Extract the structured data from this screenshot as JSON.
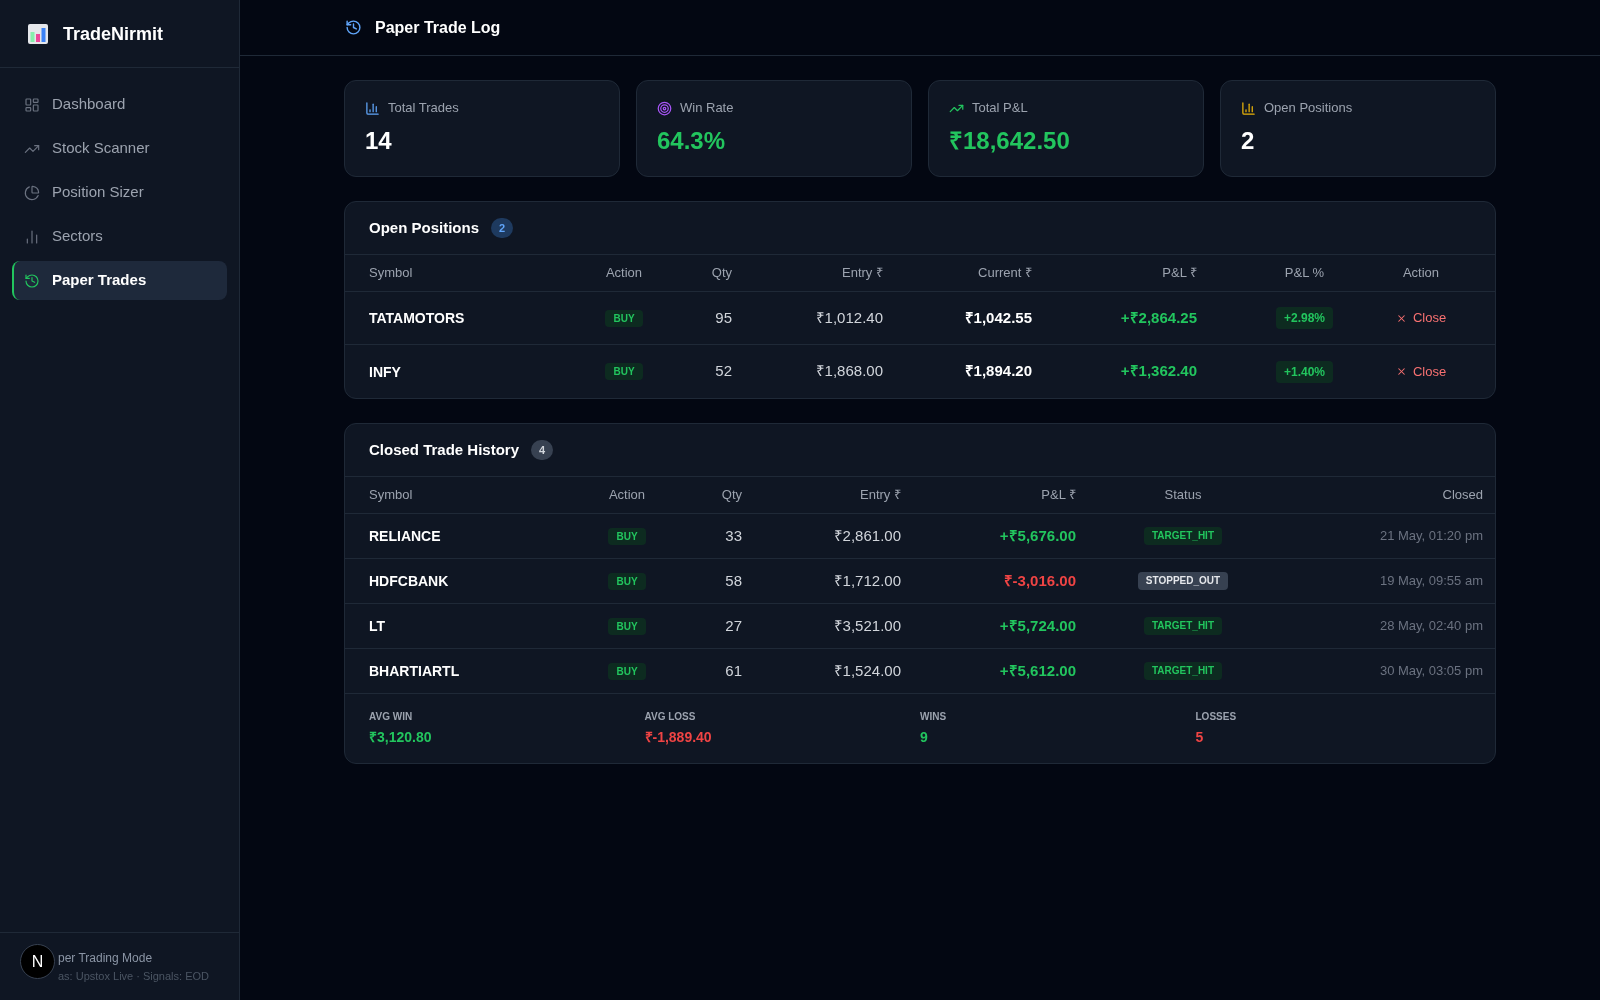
{
  "sidebar": {
    "brand": "TradeNirmit",
    "nav": [
      {
        "kind": "dashboard",
        "label": "Dashboard",
        "selected": false
      },
      {
        "kind": "scanner",
        "label": "Stock Scanner",
        "selected": false
      },
      {
        "kind": "sizer",
        "label": "Position Sizer",
        "selected": false
      },
      {
        "kind": "sectors",
        "label": "Sectors",
        "selected": false
      },
      {
        "kind": "trades",
        "label": "Paper Trades",
        "selected": true
      }
    ],
    "footer": {
      "mode": "per Trading Mode",
      "sources": "as: Upstox Live · Signals: EOD"
    }
  },
  "dev_badge": {
    "label": "N"
  },
  "header": {
    "title": "Paper Trade Log"
  },
  "stats": [
    {
      "kind": "trades",
      "label": "Total Trades",
      "value": "14"
    },
    {
      "kind": "win_rate",
      "label": "Win Rate",
      "value": "64.3%"
    },
    {
      "kind": "pnl",
      "label": "Total P&L",
      "value": "₹18,642.50"
    },
    {
      "kind": "open",
      "label": "Open Positions",
      "value": "2"
    }
  ],
  "open_positions": {
    "title": "Open Positions",
    "count": "2",
    "columns": [
      "Symbol",
      "Action",
      "Qty",
      "Entry ₹",
      "Current ₹",
      "P&L ₹",
      "P&L %",
      "Action"
    ],
    "rows": [
      {
        "symbol": "TATAMOTORS",
        "action": "BUY",
        "qty": "95",
        "entry": "₹1,012.40",
        "current": "₹1,042.55",
        "pnl": "+₹2,864.25",
        "pnl_pct": "+2.98%",
        "profit": true,
        "close": "Close"
      },
      {
        "symbol": "INFY",
        "action": "BUY",
        "qty": "52",
        "entry": "₹1,868.00",
        "current": "₹1,894.20",
        "pnl": "+₹1,362.40",
        "pnl_pct": "+1.40%",
        "profit": true,
        "close": "Close"
      }
    ]
  },
  "closed_trades": {
    "title": "Closed Trade History",
    "count": "4",
    "columns": [
      "Symbol",
      "Action",
      "Qty",
      "Entry ₹",
      "P&L ₹",
      "Status",
      "Closed"
    ],
    "rows": [
      {
        "symbol": "RELIANCE",
        "action": "BUY",
        "qty": "33",
        "entry": "₹2,861.00",
        "pnl": "+₹5,676.00",
        "profit": true,
        "status": {
          "kind": "target",
          "label": "TARGET_HIT"
        },
        "closed": "21 May, 01:20 pm"
      },
      {
        "symbol": "HDFCBANK",
        "action": "BUY",
        "qty": "58",
        "entry": "₹1,712.00",
        "pnl": "₹-3,016.00",
        "profit": false,
        "status": {
          "kind": "stopped",
          "label": "STOPPED_OUT"
        },
        "closed": "19 May, 09:55 am"
      },
      {
        "symbol": "LT",
        "action": "BUY",
        "qty": "27",
        "entry": "₹3,521.00",
        "pnl": "+₹5,724.00",
        "profit": true,
        "status": {
          "kind": "target",
          "label": "TARGET_HIT"
        },
        "closed": "28 May, 02:40 pm"
      },
      {
        "symbol": "BHARTIARTL",
        "action": "BUY",
        "qty": "61",
        "entry": "₹1,524.00",
        "pnl": "+₹5,612.00",
        "profit": true,
        "status": {
          "kind": "target",
          "label": "TARGET_HIT"
        },
        "closed": "30 May, 03:05 pm"
      }
    ],
    "summary": [
      {
        "label": "AVG WIN",
        "value": "₹3,120.80",
        "profit": true
      },
      {
        "label": "AVG LOSS",
        "value": "₹-1,889.40",
        "profit": false
      },
      {
        "label": "WINS",
        "value": "9",
        "profit": true
      },
      {
        "label": "LOSSES",
        "value": "5",
        "profit": false
      }
    ]
  }
}
